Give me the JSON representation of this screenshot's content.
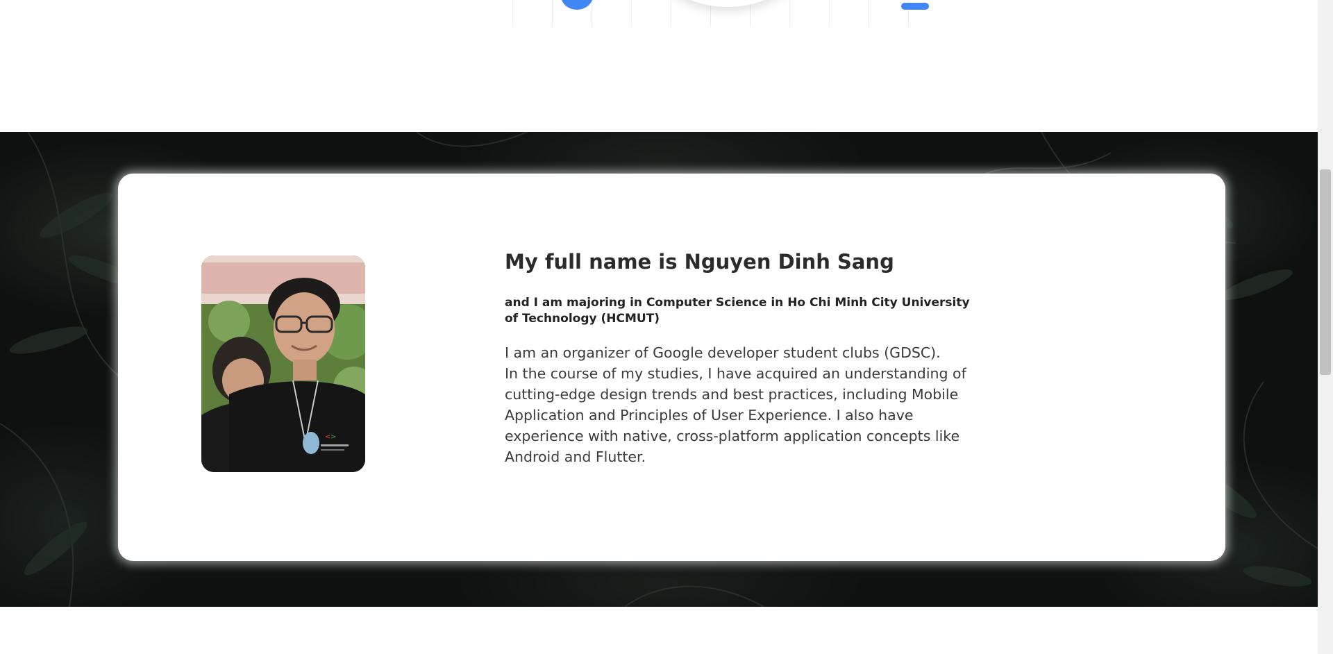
{
  "about": {
    "heading": "My full name is Nguyen Dinh Sang",
    "subheading": "and I am majoring in Computer Science in Ho Chi Minh City University of Technology (HCMUT)",
    "body_lines": [
      "I am an organizer of Google developer student clubs (GDSC).",
      "In the course of my studies, I have acquired an understanding of cutting-edge design trends and best practices, including Mobile Application and Principles of User Experience. I also have experience with native, cross-platform application concepts like Android and Flutter."
    ]
  },
  "colors": {
    "accent": "#4285f4",
    "band_background": "#0e1110",
    "card_background": "#ffffff",
    "text": "#2b2b2b"
  }
}
